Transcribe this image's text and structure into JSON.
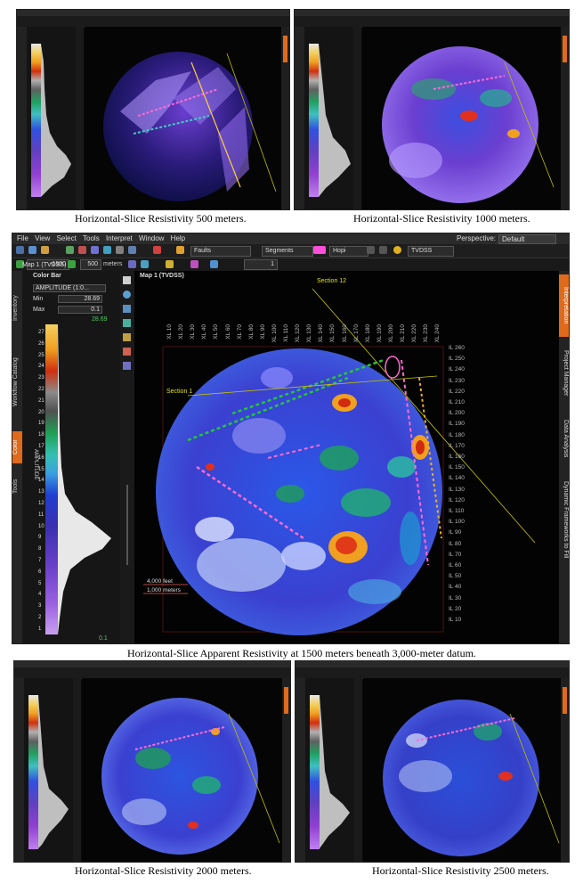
{
  "captions": {
    "p500": "Horizontal-Slice Resistivity 500 meters.",
    "p1000": "Horizontal-Slice Resistivity 1000 meters.",
    "p1500": "Horizontal-Slice Apparent Resistivity at 1500 meters beneath 3,000-meter datum.",
    "p2000": "Horizontal-Slice Resistivity 2000 meters.",
    "p2500": "Horizontal-Slice Resistivity 2500 meters."
  },
  "main": {
    "menu": [
      "File",
      "View",
      "Select",
      "Tools",
      "Interpret",
      "Window",
      "Help"
    ],
    "perspective_label": "Perspective:",
    "perspective_value": "Default",
    "faults_label": "Faults",
    "segments_label": "Segments",
    "horizon_label": "Hopi",
    "domain_label": "TVDSS",
    "depth_value": "-1500",
    "step_value": "500",
    "step_unit": "meters",
    "frame_value": "1",
    "panel_tab": "Map 1 (TVDSS)",
    "left_tabs": [
      "Inventory",
      "Workflow Catalog",
      "Color",
      "Tools"
    ],
    "colorbar": {
      "title": "Color Bar",
      "attribute": "AMPLITUDE (1:0...",
      "min_label": "Min",
      "min_value": "28.69",
      "max_label": "Max",
      "max_value": "0.1",
      "top_value": "28.69",
      "bottom_value": "0.1",
      "axis_label": "AMPLITUDE",
      "ticks": [
        "27",
        "26",
        "25",
        "24",
        "23",
        "22",
        "21",
        "20",
        "19",
        "18",
        "17",
        "16",
        "15",
        "14",
        "13",
        "12",
        "11",
        "10",
        "9",
        "8",
        "7",
        "6",
        "5",
        "4",
        "3",
        "2",
        "1"
      ]
    },
    "map_title": "Map 1 (TVDSS)",
    "section12": "Section 12",
    "section1": "Section 1",
    "il_labels": [
      "IL 260",
      "IL 250",
      "IL 240",
      "IL 230",
      "IL 220",
      "IL 210",
      "IL 200",
      "IL 190",
      "IL 180",
      "IL 170",
      "IL 160",
      "IL 150",
      "IL 140",
      "IL 130",
      "IL 120",
      "IL 110",
      "IL 100",
      "IL 90",
      "IL 80",
      "IL 70",
      "IL 60",
      "IL 50",
      "IL 40",
      "IL 30",
      "IL 20",
      "IL 10"
    ],
    "xl_labels": [
      "XL 10",
      "XL 20",
      "XL 30",
      "XL 40",
      "XL 50",
      "XL 60",
      "XL 70",
      "XL 80",
      "XL 90",
      "XL 100",
      "XL 110",
      "XL 120",
      "XL 130",
      "XL 140",
      "XL 150",
      "XL 160",
      "XL 170",
      "XL 180",
      "XL 190",
      "XL 200",
      "XL 210",
      "XL 220",
      "XL 230",
      "XL 240"
    ],
    "scale_feet": "4,000 feet",
    "scale_meters": "1,000 meters",
    "right_tabs": [
      "Interpretation",
      "Project Manager",
      "Data Analysis",
      "Dynamic Frameworks to Fill"
    ]
  },
  "colors": {
    "accent_orange": "#e06a1c",
    "selection_green": "#22c83a",
    "horizon_pink": "#ff4fd8"
  }
}
